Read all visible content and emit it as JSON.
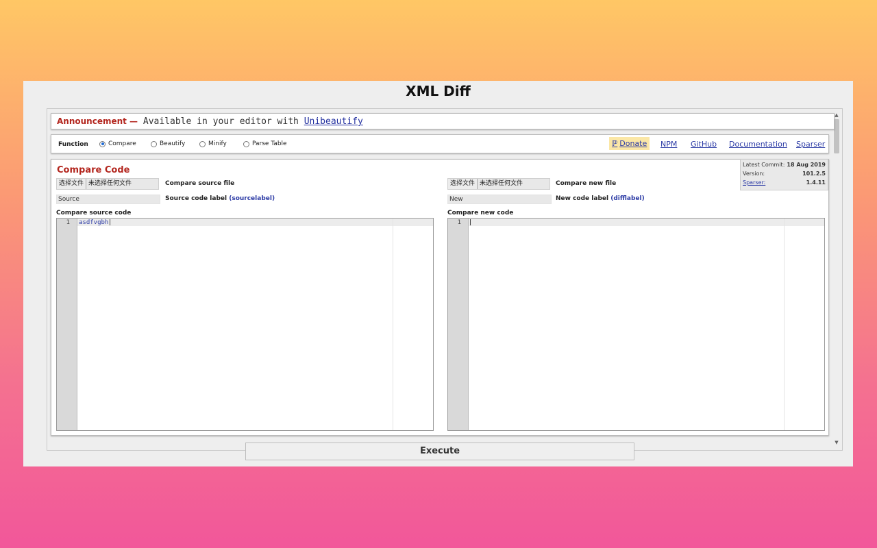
{
  "app": {
    "title": "XML Diff"
  },
  "announcement": {
    "lead": "Announcement —",
    "text": "Available in your editor with",
    "link": "Unibeautify"
  },
  "function_bar": {
    "label": "Function",
    "options": [
      {
        "label": "Compare",
        "selected": true
      },
      {
        "label": "Beautify",
        "selected": false
      },
      {
        "label": "Minify",
        "selected": false
      },
      {
        "label": "Parse Table",
        "selected": false
      }
    ],
    "donate": "Donate",
    "donate_icon": "paypal-icon",
    "links": [
      "NPM",
      "GitHub",
      "Documentation",
      "Sparser"
    ]
  },
  "compare": {
    "title": "Compare Code",
    "source_file": {
      "button": "选择文件",
      "status": "未选择任何文件",
      "label": "Compare source file"
    },
    "new_file": {
      "button": "选择文件",
      "status": "未选择任何文件",
      "label": "Compare new file"
    },
    "source_label_input": "Source",
    "source_label_text": "Source code label",
    "source_label_hint": "(sourcelabel)",
    "new_label_input": "New",
    "new_label_text": "New code label",
    "new_label_hint": "(difflabel)",
    "source_code_heading": "Compare source code",
    "new_code_heading": "Compare new code",
    "source_line_number": "1",
    "source_code_line": "asdfvgbh",
    "new_line_number": "1",
    "new_code_line": ""
  },
  "meta": {
    "latest_commit_label": "Latest Commit:",
    "latest_commit_value": "18 Aug 2019",
    "version_label": "Version:",
    "version_value": "101.2.5",
    "sparser_label": "Sparser:",
    "sparser_value": "1.4.11"
  },
  "execute": {
    "label": "Execute"
  },
  "colors": {
    "accent_red": "#b3261e",
    "link_blue": "#2b3aa5"
  }
}
